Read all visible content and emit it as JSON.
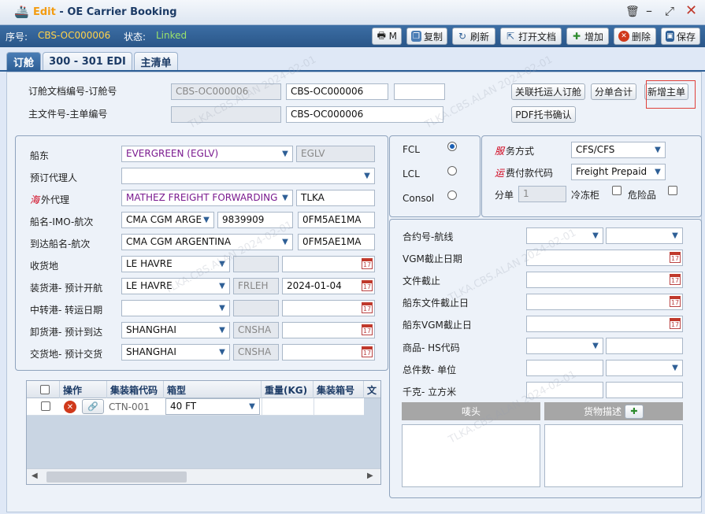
{
  "window": {
    "edit_label": "Edit",
    "title_sep": " - ",
    "title": "OE Carrier Booking"
  },
  "info": {
    "seq_label": "序号:",
    "seq_value": "CBS-OC000006",
    "status_label": "状态:",
    "status_value": "Linked"
  },
  "toolbar": {
    "print": "M",
    "copy": "复制",
    "refresh": "刷新",
    "open_doc": "打开文档",
    "add": "增加",
    "delete": "删除",
    "save": "保存"
  },
  "tabs": [
    {
      "label": "订舱"
    },
    {
      "label": "300 - 301 EDI"
    },
    {
      "label": "主清单"
    }
  ],
  "header": {
    "booking_doc_label": "订舱文档编号-订舱号",
    "booking_doc_no": "CBS-OC000006",
    "booking_no": "CBS-OC000006",
    "master_doc_label": "主文件号-主单编号",
    "master_no": "CBS-OC000006",
    "btn_link_shipper": "关联托运人订舱",
    "btn_split_total": "分单合计",
    "btn_new_master": "新增主单",
    "btn_pdf": "PDF托书确认"
  },
  "left": {
    "carrier_label": "船东",
    "carrier": "EVERGREEN (EGLV)",
    "carrier_code": "EGLV",
    "agent_label": "预订代理人",
    "agent": "",
    "overseas_prefix": "海",
    "overseas_label": "外代理",
    "overseas": "MATHEZ FREIGHT FORWARDING",
    "overseas_code": "TLKA",
    "vessel_label": "船名-IMO-航次",
    "vessel": "CMA CGM ARGE",
    "imo": "9839909",
    "voyage": "0FM5AE1MA",
    "arr_vessel_label": "到达船名-航次",
    "arr_vessel": "CMA CGM ARGENTINA",
    "arr_voyage": "0FM5AE1MA",
    "receipt_label": "收货地",
    "receipt": "LE HAVRE",
    "pol_label": "装货港- 预计开航",
    "pol": "LE HAVRE",
    "pol_code": "FRLEH",
    "etd": "2024-01-04",
    "transit_label": "中转港- 转运日期",
    "transit": "",
    "pod_label": "卸货港- 预计到达",
    "pod": "SHANGHAI",
    "pod_code": "CNSHA",
    "delivery_label": "交货地- 预计交货",
    "delivery": "SHANGHAI",
    "delivery_code": "CNSHA"
  },
  "grid": {
    "headers": [
      "操作",
      "集装箱代码",
      "箱型",
      "重量(KG)",
      "集装箱号",
      "文"
    ],
    "rows": [
      {
        "container_code": "CTN-001",
        "type": "40 FT",
        "weight": "",
        "container_no": ""
      }
    ]
  },
  "load": {
    "fcl": "FCL",
    "lcl": "LCL",
    "consol": "Consol",
    "selected": "FCL"
  },
  "service": {
    "svc_prefix": "服",
    "svc_label": "务方式",
    "svc": "CFS/CFS",
    "freight_prefix": "运",
    "freight_label": "费付款代码",
    "freight": "Freight Prepaid",
    "split_label": "分单",
    "split_value": "1",
    "reefer_label": "冷冻柜",
    "dg_label": "危险品"
  },
  "right": {
    "contract_label": "合约号-航线",
    "vgm_label": "VGM截止日期",
    "doc_cut_label": "文件截止",
    "carrier_doc_cut_label": "船东文件截止日",
    "carrier_vgm_label": "船东VGM截止日",
    "hs_label": "商品-  HS代码",
    "pkgs_label": "总件数- 单位",
    "kg_cbm_label": "千克- 立方米",
    "marks_label": "唛头",
    "desc_label": "货物描述"
  },
  "watermark": "TLKA.CBS.ALAN 2024-02-01"
}
